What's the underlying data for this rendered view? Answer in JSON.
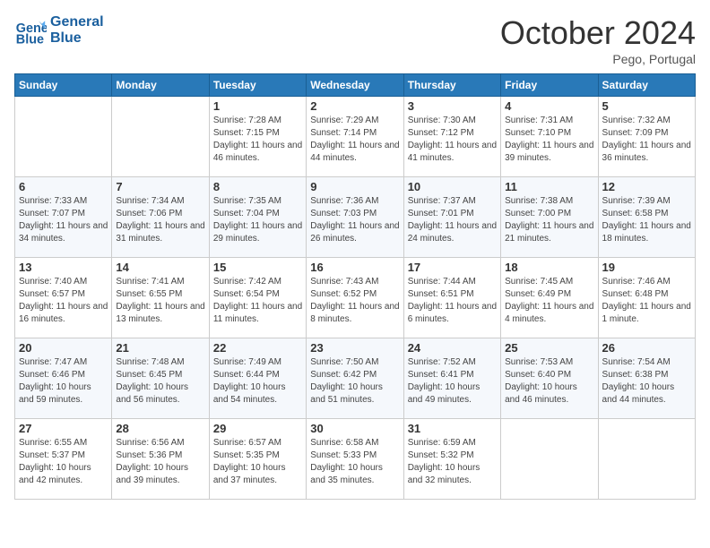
{
  "header": {
    "logo_line1": "General",
    "logo_line2": "Blue",
    "month": "October 2024",
    "location": "Pego, Portugal"
  },
  "days_of_week": [
    "Sunday",
    "Monday",
    "Tuesday",
    "Wednesday",
    "Thursday",
    "Friday",
    "Saturday"
  ],
  "weeks": [
    [
      {
        "day": "",
        "content": ""
      },
      {
        "day": "",
        "content": ""
      },
      {
        "day": "1",
        "content": "Sunrise: 7:28 AM\nSunset: 7:15 PM\nDaylight: 11 hours and 46 minutes."
      },
      {
        "day": "2",
        "content": "Sunrise: 7:29 AM\nSunset: 7:14 PM\nDaylight: 11 hours and 44 minutes."
      },
      {
        "day": "3",
        "content": "Sunrise: 7:30 AM\nSunset: 7:12 PM\nDaylight: 11 hours and 41 minutes."
      },
      {
        "day": "4",
        "content": "Sunrise: 7:31 AM\nSunset: 7:10 PM\nDaylight: 11 hours and 39 minutes."
      },
      {
        "day": "5",
        "content": "Sunrise: 7:32 AM\nSunset: 7:09 PM\nDaylight: 11 hours and 36 minutes."
      }
    ],
    [
      {
        "day": "6",
        "content": "Sunrise: 7:33 AM\nSunset: 7:07 PM\nDaylight: 11 hours and 34 minutes."
      },
      {
        "day": "7",
        "content": "Sunrise: 7:34 AM\nSunset: 7:06 PM\nDaylight: 11 hours and 31 minutes."
      },
      {
        "day": "8",
        "content": "Sunrise: 7:35 AM\nSunset: 7:04 PM\nDaylight: 11 hours and 29 minutes."
      },
      {
        "day": "9",
        "content": "Sunrise: 7:36 AM\nSunset: 7:03 PM\nDaylight: 11 hours and 26 minutes."
      },
      {
        "day": "10",
        "content": "Sunrise: 7:37 AM\nSunset: 7:01 PM\nDaylight: 11 hours and 24 minutes."
      },
      {
        "day": "11",
        "content": "Sunrise: 7:38 AM\nSunset: 7:00 PM\nDaylight: 11 hours and 21 minutes."
      },
      {
        "day": "12",
        "content": "Sunrise: 7:39 AM\nSunset: 6:58 PM\nDaylight: 11 hours and 18 minutes."
      }
    ],
    [
      {
        "day": "13",
        "content": "Sunrise: 7:40 AM\nSunset: 6:57 PM\nDaylight: 11 hours and 16 minutes."
      },
      {
        "day": "14",
        "content": "Sunrise: 7:41 AM\nSunset: 6:55 PM\nDaylight: 11 hours and 13 minutes."
      },
      {
        "day": "15",
        "content": "Sunrise: 7:42 AM\nSunset: 6:54 PM\nDaylight: 11 hours and 11 minutes."
      },
      {
        "day": "16",
        "content": "Sunrise: 7:43 AM\nSunset: 6:52 PM\nDaylight: 11 hours and 8 minutes."
      },
      {
        "day": "17",
        "content": "Sunrise: 7:44 AM\nSunset: 6:51 PM\nDaylight: 11 hours and 6 minutes."
      },
      {
        "day": "18",
        "content": "Sunrise: 7:45 AM\nSunset: 6:49 PM\nDaylight: 11 hours and 4 minutes."
      },
      {
        "day": "19",
        "content": "Sunrise: 7:46 AM\nSunset: 6:48 PM\nDaylight: 11 hours and 1 minute."
      }
    ],
    [
      {
        "day": "20",
        "content": "Sunrise: 7:47 AM\nSunset: 6:46 PM\nDaylight: 10 hours and 59 minutes."
      },
      {
        "day": "21",
        "content": "Sunrise: 7:48 AM\nSunset: 6:45 PM\nDaylight: 10 hours and 56 minutes."
      },
      {
        "day": "22",
        "content": "Sunrise: 7:49 AM\nSunset: 6:44 PM\nDaylight: 10 hours and 54 minutes."
      },
      {
        "day": "23",
        "content": "Sunrise: 7:50 AM\nSunset: 6:42 PM\nDaylight: 10 hours and 51 minutes."
      },
      {
        "day": "24",
        "content": "Sunrise: 7:52 AM\nSunset: 6:41 PM\nDaylight: 10 hours and 49 minutes."
      },
      {
        "day": "25",
        "content": "Sunrise: 7:53 AM\nSunset: 6:40 PM\nDaylight: 10 hours and 46 minutes."
      },
      {
        "day": "26",
        "content": "Sunrise: 7:54 AM\nSunset: 6:38 PM\nDaylight: 10 hours and 44 minutes."
      }
    ],
    [
      {
        "day": "27",
        "content": "Sunrise: 6:55 AM\nSunset: 5:37 PM\nDaylight: 10 hours and 42 minutes."
      },
      {
        "day": "28",
        "content": "Sunrise: 6:56 AM\nSunset: 5:36 PM\nDaylight: 10 hours and 39 minutes."
      },
      {
        "day": "29",
        "content": "Sunrise: 6:57 AM\nSunset: 5:35 PM\nDaylight: 10 hours and 37 minutes."
      },
      {
        "day": "30",
        "content": "Sunrise: 6:58 AM\nSunset: 5:33 PM\nDaylight: 10 hours and 35 minutes."
      },
      {
        "day": "31",
        "content": "Sunrise: 6:59 AM\nSunset: 5:32 PM\nDaylight: 10 hours and 32 minutes."
      },
      {
        "day": "",
        "content": ""
      },
      {
        "day": "",
        "content": ""
      }
    ]
  ]
}
